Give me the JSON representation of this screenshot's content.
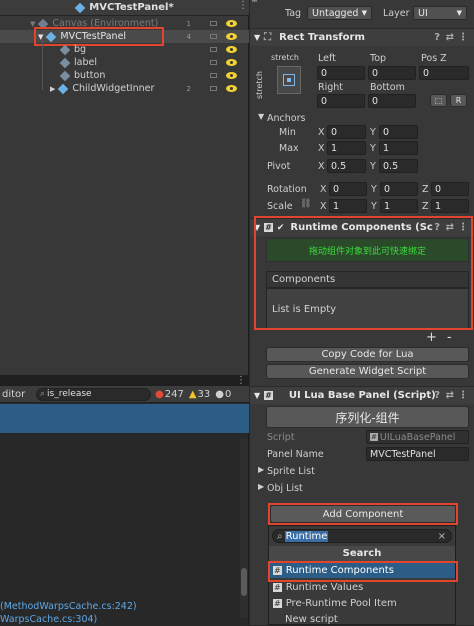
{
  "hierarchy": {
    "title": "MVCTestPanel*",
    "rows": [
      {
        "label": "Canvas (Environment)",
        "count": "1"
      },
      {
        "label": "MVCTestPanel",
        "count": "4"
      },
      {
        "label": "bg",
        "count": ""
      },
      {
        "label": "label",
        "count": ""
      },
      {
        "label": "button",
        "count": ""
      },
      {
        "label": "ChildWidgetInner",
        "count": "2"
      }
    ]
  },
  "inspector": {
    "tag_label": "Tag",
    "tag_value": "Untagged",
    "layer_label": "Layer",
    "layer_value": "UI",
    "rect_transform": {
      "title": "Rect Transform",
      "stretch_top": "stretch",
      "stretch_side": "stretch",
      "cols_top": [
        "Left",
        "Top",
        "Pos Z"
      ],
      "vals_top": [
        "0",
        "0",
        "0"
      ],
      "cols_bottom": [
        "Right",
        "Bottom"
      ],
      "vals_bottom": [
        "0",
        "0"
      ],
      "r_button": "R",
      "anchors": "Anchors",
      "min": "Min",
      "min_x": "0",
      "min_y": "0",
      "max": "Max",
      "max_x": "1",
      "max_y": "1",
      "pivot": "Pivot",
      "pivot_x": "0.5",
      "pivot_y": "0.5",
      "rotation": "Rotation",
      "rot_x": "0",
      "rot_y": "0",
      "rot_z": "0",
      "scale": "Scale",
      "scale_x": "1",
      "scale_y": "1",
      "scale_z": "1",
      "x": "X",
      "y": "Y",
      "z": "Z"
    },
    "runtime_components": {
      "title": "Runtime Components (Sc",
      "drop_hint": "拖动组件对象到此可快速绑定",
      "list_header": "Components",
      "list_empty": "List is Empty",
      "plus": "+",
      "minus": "-",
      "copy_button": "Copy Code for Lua",
      "generate_button": "Generate Widget Script"
    },
    "lua_panel": {
      "title": "UI Lua Base Panel (Script)",
      "serialize_button": "序列化-组件",
      "script_label": "Script",
      "script_value": "UILuaBasePanel",
      "panel_name_label": "Panel Name",
      "panel_name_value": "MVCTestPanel",
      "sprite_list": "Sprite List",
      "obj_list": "Obj List",
      "add_component": "Add Component",
      "search_value": "Runtime",
      "search_header": "Search",
      "results": [
        "Runtime Components",
        "Runtime Values",
        "Pre-Runtime Pool Item",
        "New script"
      ]
    }
  },
  "console": {
    "tab": "ditor",
    "search_value": "is_release",
    "errors": "247",
    "warnings": "33",
    "infos": "0",
    "log_lines": [
      "(MethodWarpsCache.cs:242)",
      "WarpsCache.cs:304)"
    ]
  },
  "colors": {
    "highlight_red": "#e2452d",
    "selection_blue": "#2c5d87",
    "eye_yellow": "#f2d230",
    "drop_green": "#3ddc3d"
  }
}
